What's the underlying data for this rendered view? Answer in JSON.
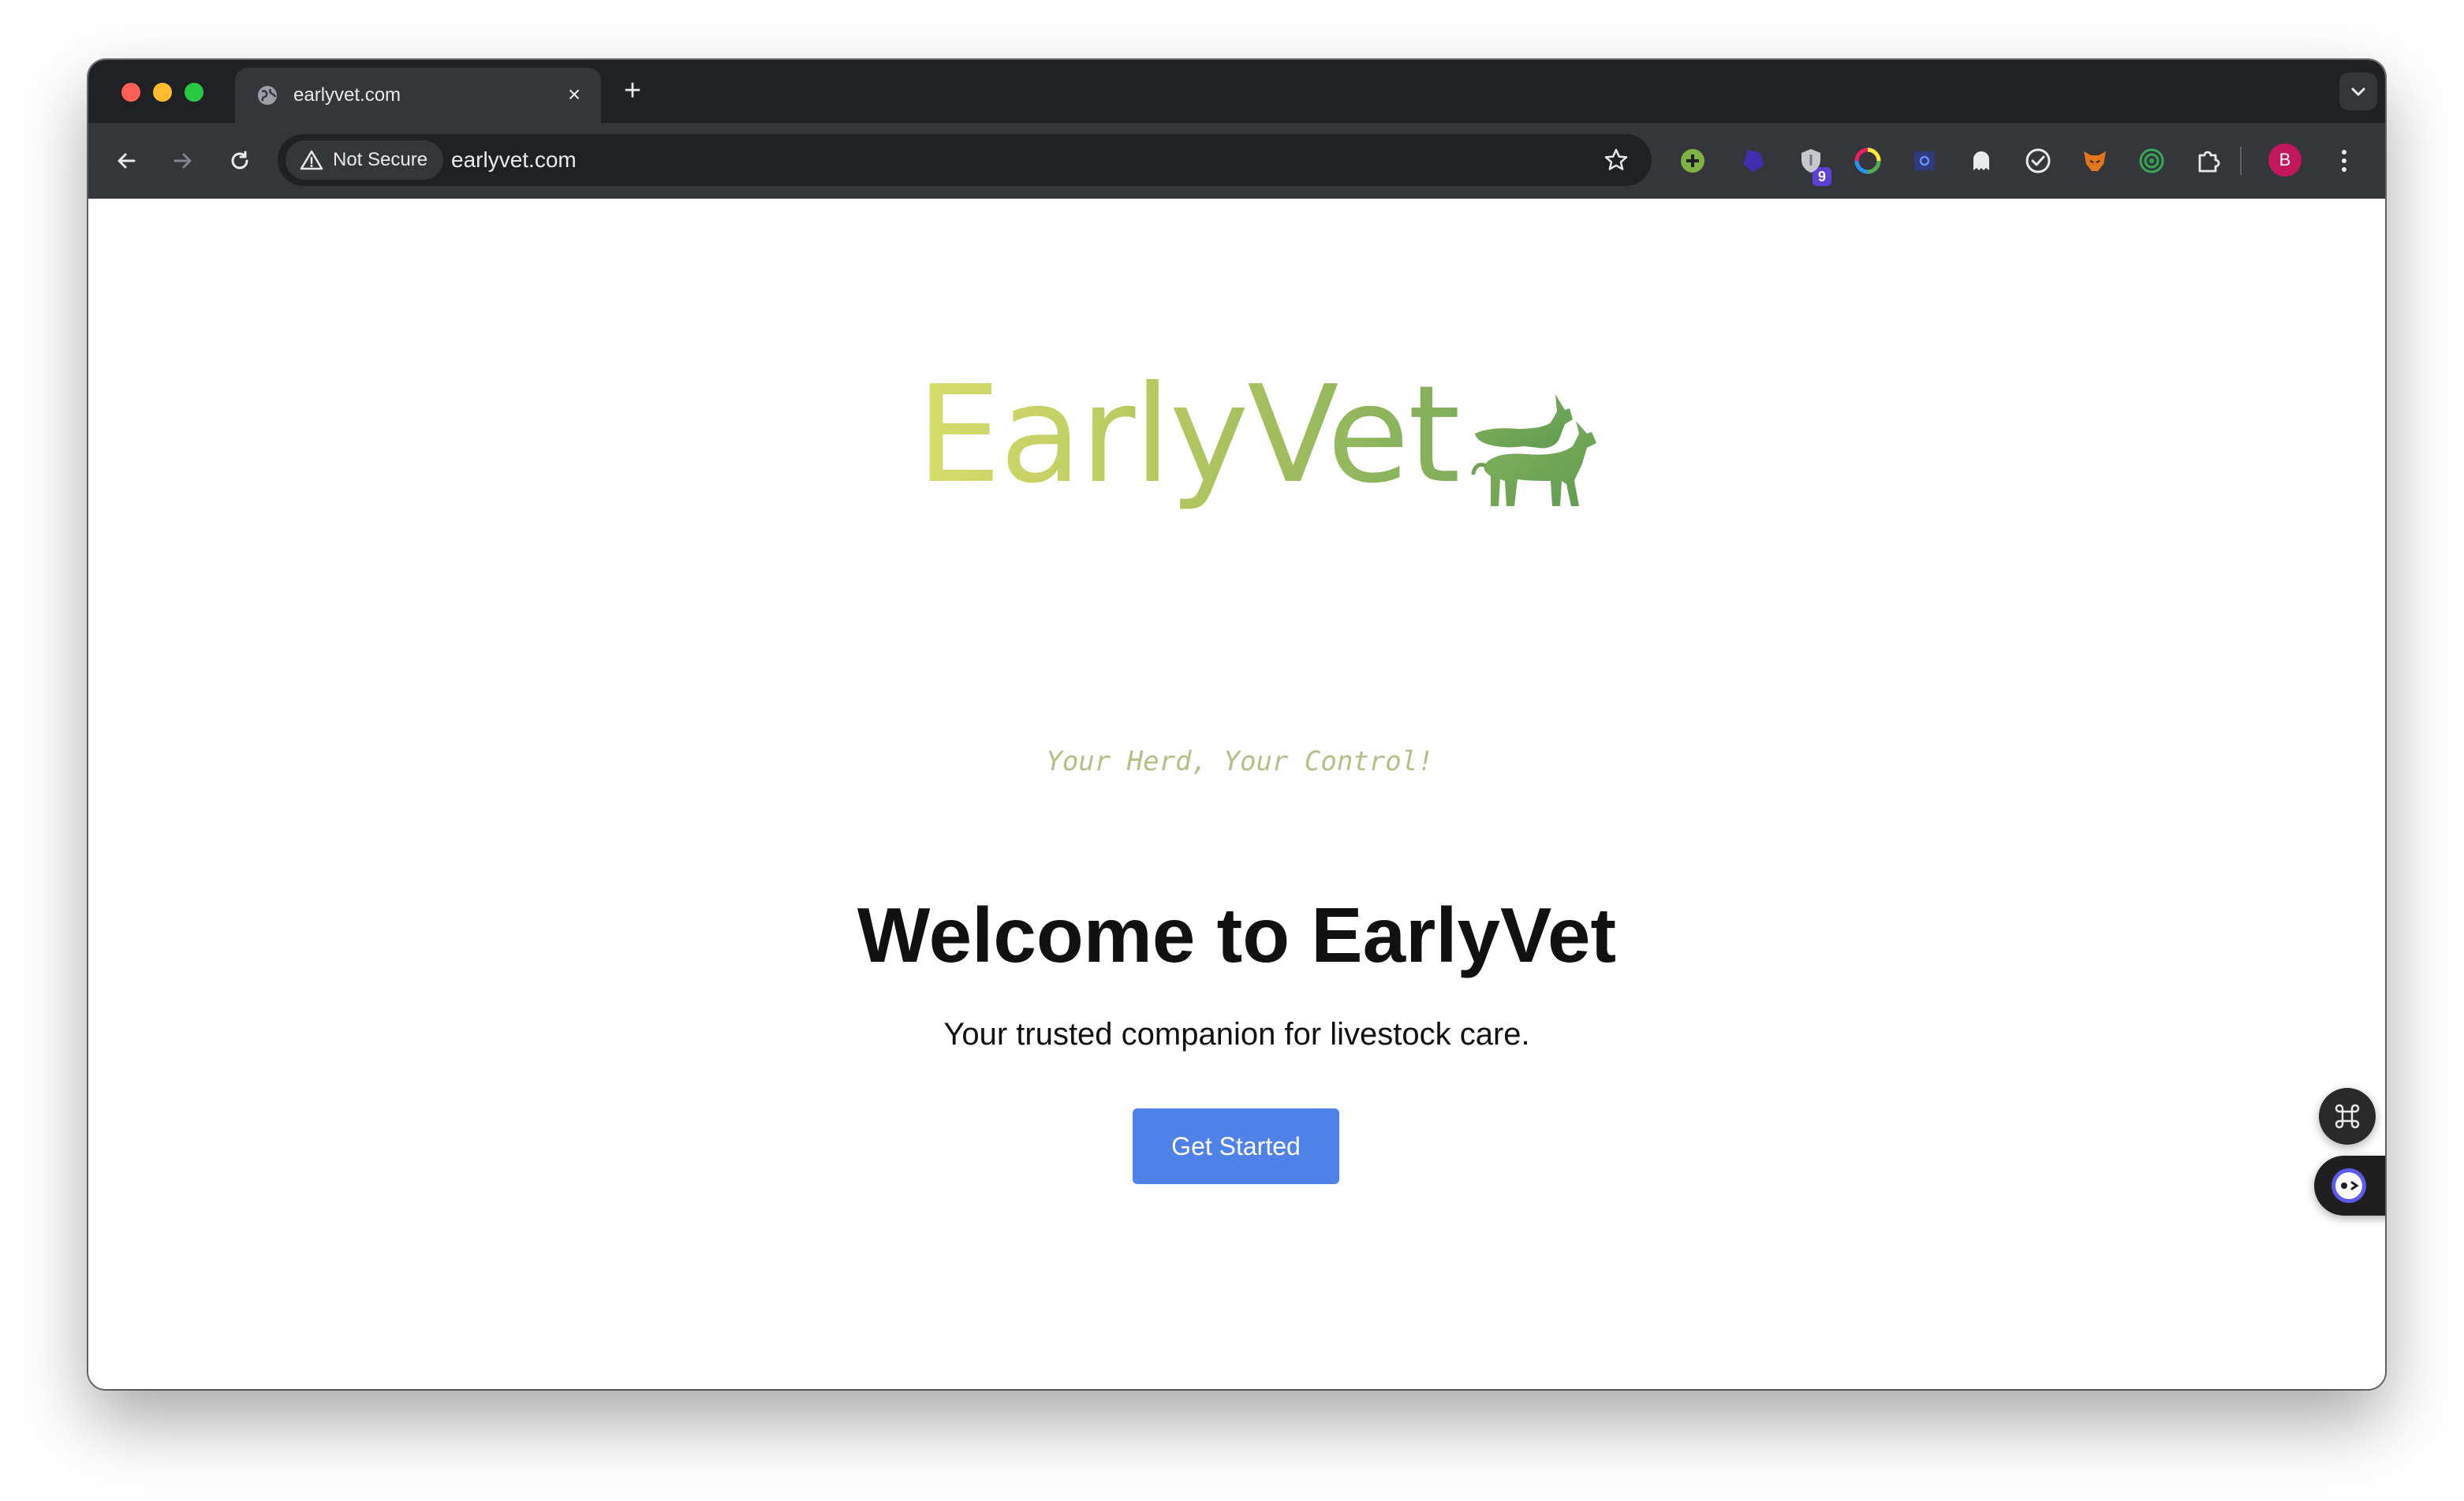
{
  "browser": {
    "tab": {
      "title": "earlyvet.com",
      "close_glyph": "×"
    },
    "new_tab_glyph": "+",
    "omnibox": {
      "security_label": "Not Secure",
      "url": "earlyvet.com"
    },
    "extensions": {
      "badge_count": "9"
    },
    "profile_initial": "B",
    "colors": {
      "tabstrip": "#202124",
      "toolbar": "#35363a",
      "omnibox": "#202124"
    }
  },
  "page": {
    "logo": {
      "wordmark": "EarlyVet",
      "icon": "goats-icon"
    },
    "tagline": "Your Herd, Your Control!",
    "heading": "Welcome to EarlyVet",
    "subtitle": "Your trusted companion for livestock care.",
    "cta_label": "Get Started",
    "colors": {
      "cta": "#4f82e9",
      "logo_gradient_start": "#d8dd6a",
      "logo_gradient_end": "#7fae5c",
      "tagline": "#b8bd88"
    }
  }
}
